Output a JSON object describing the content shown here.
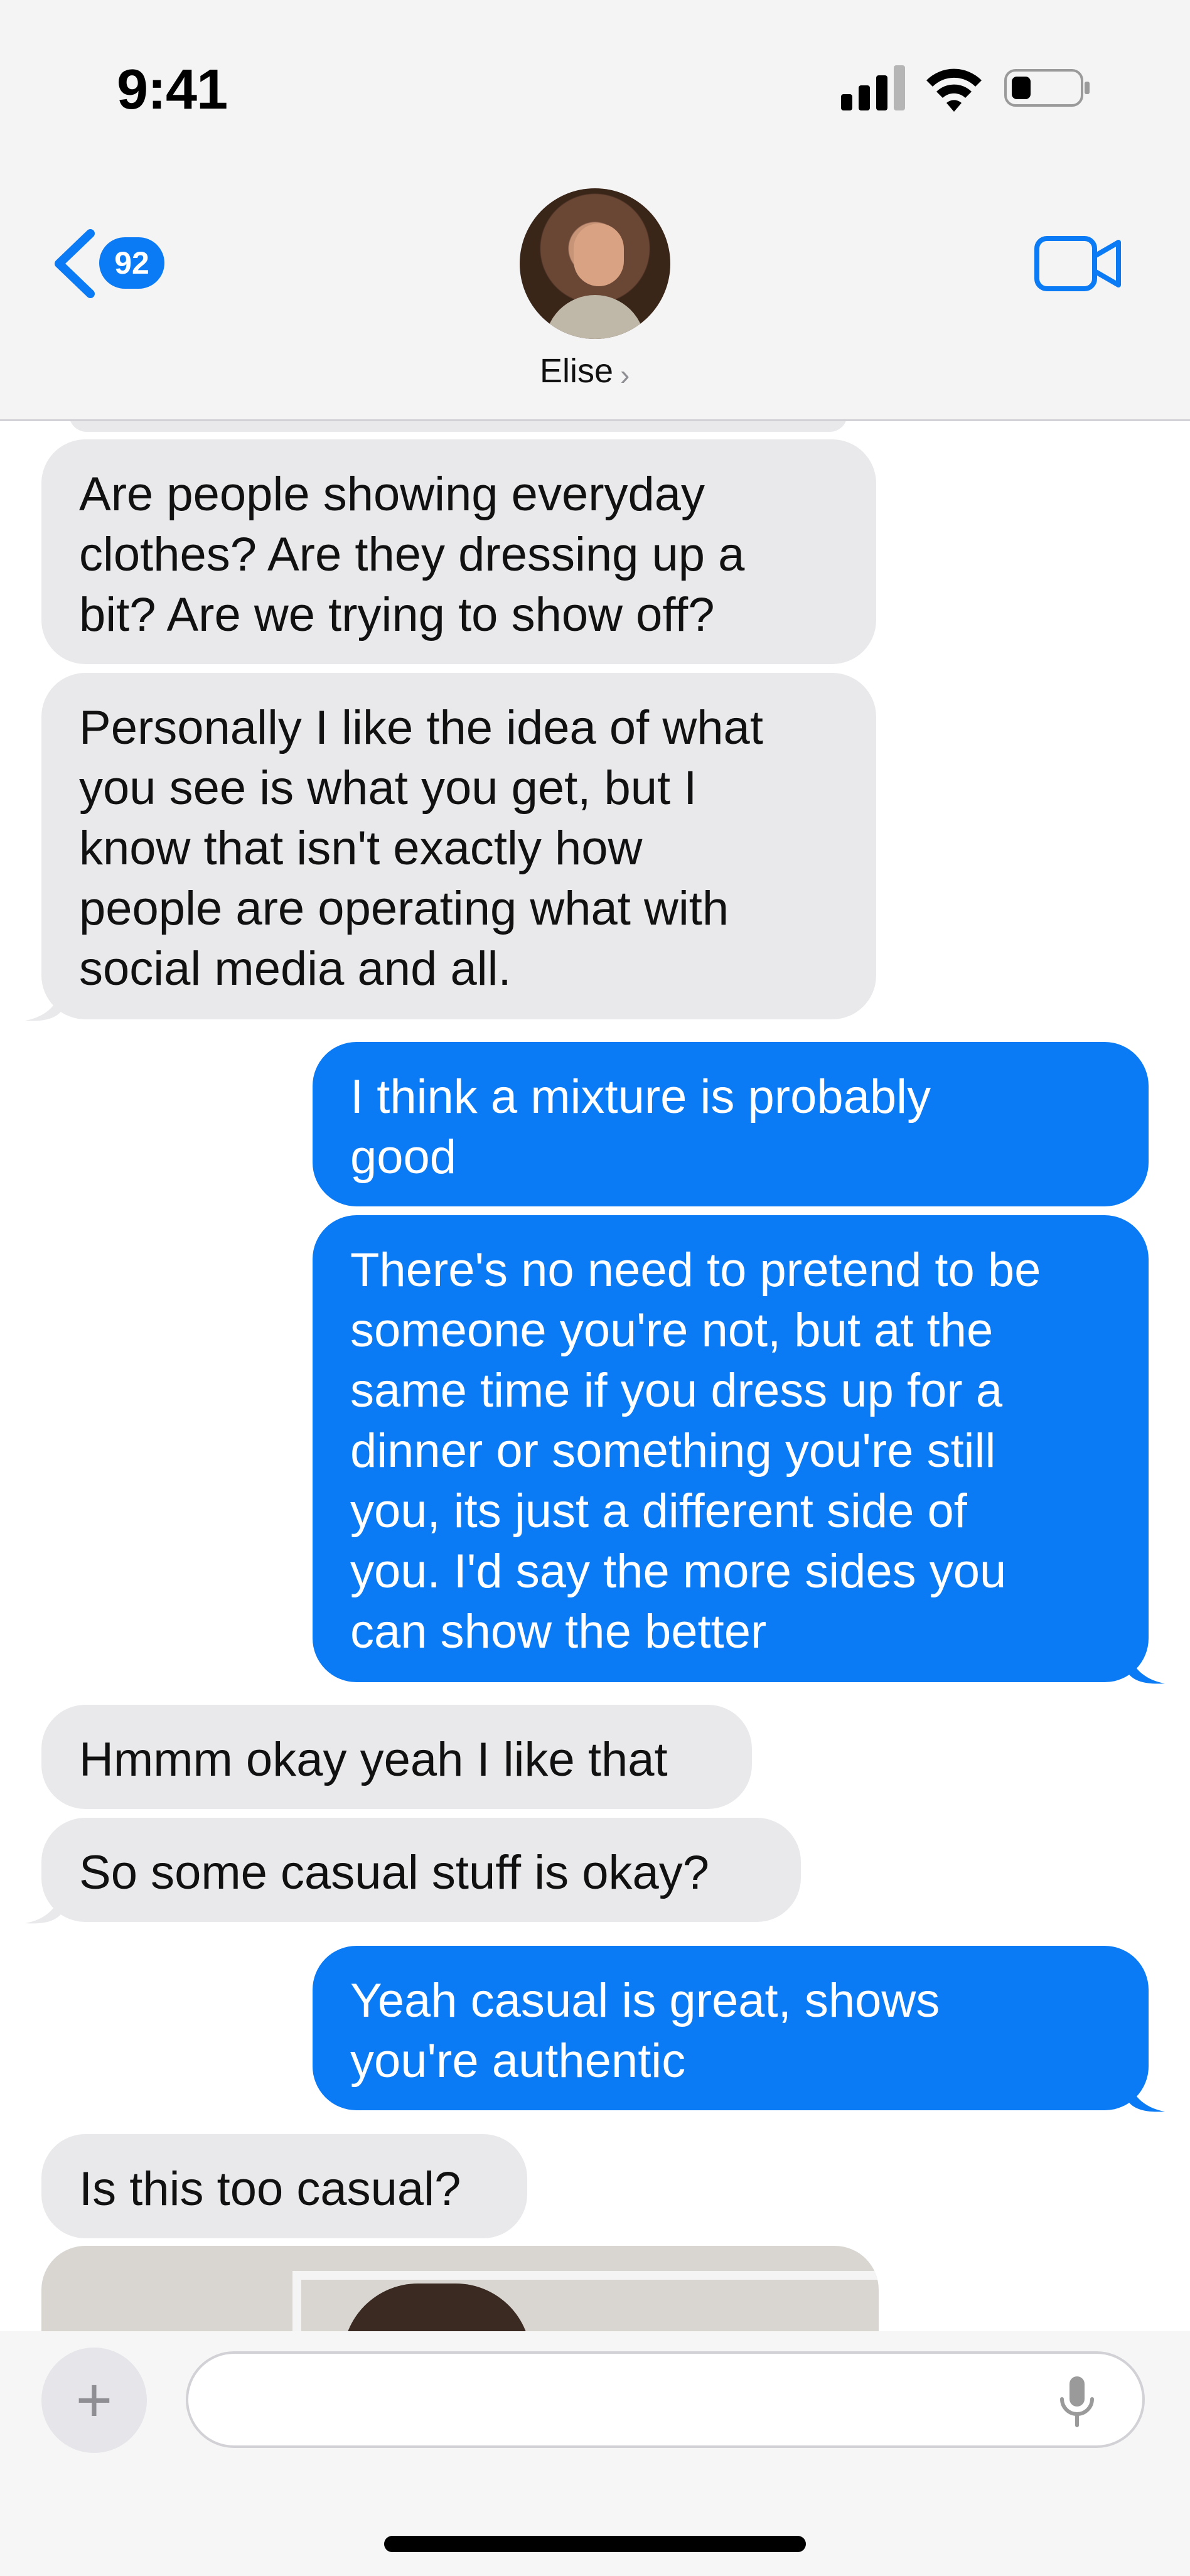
{
  "status_bar": {
    "time": "9:41"
  },
  "header": {
    "back_count": "92",
    "contact_name": "Elise",
    "contact_chevron": "›"
  },
  "messages": [
    {
      "side": "received",
      "text": "Are people showing everyday\nclothes? Are they dressing up a\nbit? Are we trying to show off?"
    },
    {
      "side": "received",
      "text": "Personally I like the idea of what\nyou see is what you get, but I\nknow that isn't exactly how\npeople are operating what with\nsocial media and all."
    },
    {
      "side": "sent",
      "text": "I think a mixture is probably\ngood"
    },
    {
      "side": "sent",
      "text": "There's no need to pretend to be\nsomeone you're not, but at the\nsame time if you dress up for a\ndinner or something you're still\nyou, its just a different side of\nyou. I'd say the more sides you\ncan show the better"
    },
    {
      "side": "received",
      "text": "Hmmm okay yeah I like that"
    },
    {
      "side": "received",
      "text": "So some casual stuff is okay?"
    },
    {
      "side": "sent",
      "text": "Yeah casual is great, shows\nyou're authentic"
    },
    {
      "side": "received",
      "text": "Is this too casual?"
    }
  ],
  "composer": {
    "plus_label": "+",
    "placeholder": ""
  },
  "colors": {
    "sent_bubble": "#0a7bf4",
    "received_bubble": "#e9e9eb",
    "accent": "#0a7bf4"
  }
}
